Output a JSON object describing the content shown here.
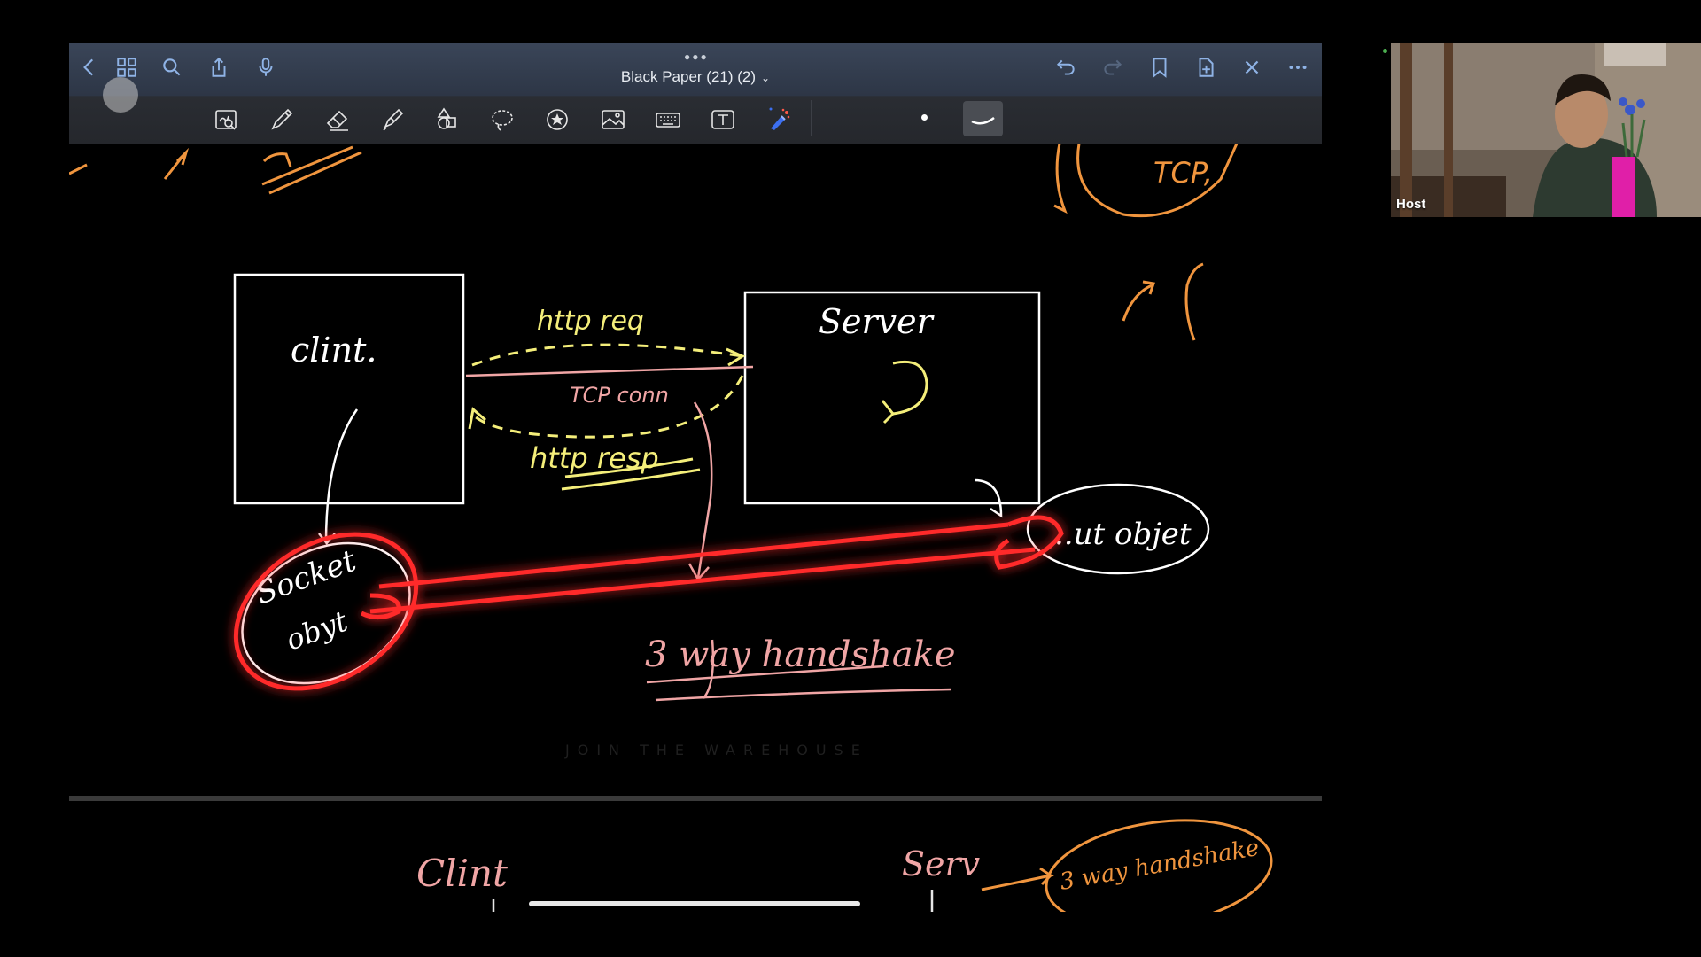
{
  "document": {
    "title": "Black Paper  (21) (2)"
  },
  "toolbar": {
    "left_icons": [
      "back-icon",
      "grid-icon",
      "search-icon",
      "share-icon",
      "microphone-icon"
    ],
    "right_icons": [
      "undo-icon",
      "redo-icon",
      "bookmark-icon",
      "add-page-icon",
      "close-icon",
      "more-icon"
    ],
    "tools": [
      "zoom-window-tool",
      "pen-tool",
      "eraser-tool",
      "highlighter-tool",
      "shapes-tool",
      "lasso-tool",
      "sticker-tool",
      "image-tool",
      "keyboard-tool",
      "text-tool",
      "laser-pointer-tool"
    ]
  },
  "participant": {
    "name": "Host"
  },
  "colors": {
    "toolbar_top": "#36405a",
    "toolbar_bottom": "#26282d",
    "yellow_ink": "#f4ee7a",
    "pink_ink": "#f0a5a5",
    "orange_ink": "#f0953e",
    "laser_red": "#ff3a3a"
  }
}
